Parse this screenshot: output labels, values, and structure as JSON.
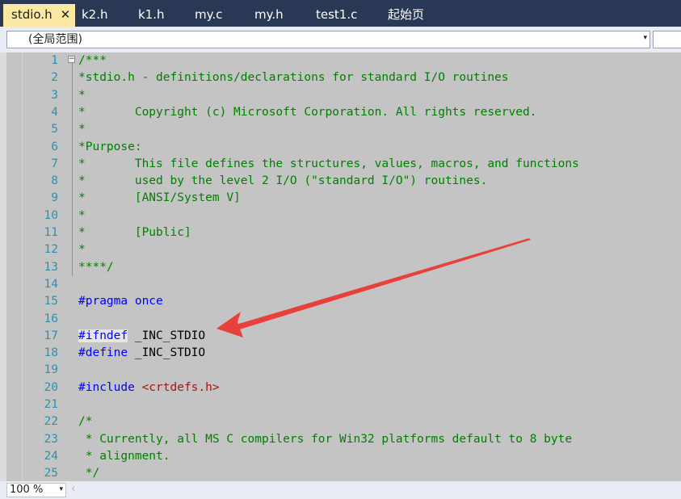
{
  "tabs": [
    {
      "label": "stdio.h",
      "active": true
    },
    {
      "label": "k2.h"
    },
    {
      "label": "k1.h"
    },
    {
      "label": "my.c"
    },
    {
      "label": "my.h"
    },
    {
      "label": "test1.c"
    },
    {
      "label": "起始页"
    }
  ],
  "tab_close_glyph": "✕",
  "scope": {
    "value": "(全局范围)",
    "dropdown_glyph": "▾"
  },
  "lines": [
    {
      "n": "1",
      "segs": [
        {
          "c": "cm",
          "t": "/***"
        }
      ]
    },
    {
      "n": "2",
      "segs": [
        {
          "c": "cm",
          "t": "*stdio.h - definitions/declarations for standard I/O routines"
        }
      ]
    },
    {
      "n": "3",
      "segs": [
        {
          "c": "cm",
          "t": "*"
        }
      ]
    },
    {
      "n": "4",
      "segs": [
        {
          "c": "cm",
          "t": "*       Copyright (c) Microsoft Corporation. All rights reserved."
        }
      ]
    },
    {
      "n": "5",
      "segs": [
        {
          "c": "cm",
          "t": "*"
        }
      ]
    },
    {
      "n": "6",
      "segs": [
        {
          "c": "cm",
          "t": "*Purpose:"
        }
      ]
    },
    {
      "n": "7",
      "segs": [
        {
          "c": "cm",
          "t": "*       This file defines the structures, values, macros, and functions"
        }
      ]
    },
    {
      "n": "8",
      "segs": [
        {
          "c": "cm",
          "t": "*       used by the level 2 I/O (\"standard I/O\") routines."
        }
      ]
    },
    {
      "n": "9",
      "segs": [
        {
          "c": "cm",
          "t": "*       [ANSI/System V]"
        }
      ]
    },
    {
      "n": "10",
      "segs": [
        {
          "c": "cm",
          "t": "*"
        }
      ]
    },
    {
      "n": "11",
      "segs": [
        {
          "c": "cm",
          "t": "*       [Public]"
        }
      ]
    },
    {
      "n": "12",
      "segs": [
        {
          "c": "cm",
          "t": "*"
        }
      ]
    },
    {
      "n": "13",
      "segs": [
        {
          "c": "cm",
          "t": "****/"
        }
      ]
    },
    {
      "n": "14",
      "segs": []
    },
    {
      "n": "15",
      "segs": [
        {
          "c": "pp",
          "t": "#pragma"
        },
        {
          "c": "tx",
          "t": " "
        },
        {
          "c": "pp",
          "t": "once"
        }
      ]
    },
    {
      "n": "16",
      "segs": []
    },
    {
      "n": "17",
      "segs": [
        {
          "c": "pp hl",
          "t": "#ifndef"
        },
        {
          "c": "tx",
          "t": " _INC_STDIO"
        }
      ]
    },
    {
      "n": "18",
      "segs": [
        {
          "c": "pp",
          "t": "#define"
        },
        {
          "c": "tx",
          "t": " _INC_STDIO"
        }
      ]
    },
    {
      "n": "19",
      "segs": []
    },
    {
      "n": "20",
      "segs": [
        {
          "c": "pp",
          "t": "#include"
        },
        {
          "c": "tx",
          "t": " "
        },
        {
          "c": "str",
          "t": "<crtdefs.h>"
        }
      ]
    },
    {
      "n": "21",
      "segs": []
    },
    {
      "n": "22",
      "segs": [
        {
          "c": "cm",
          "t": "/*"
        }
      ]
    },
    {
      "n": "23",
      "segs": [
        {
          "c": "cm",
          "t": " * Currently, all MS C compilers for Win32 platforms default to 8 byte"
        }
      ]
    },
    {
      "n": "24",
      "segs": [
        {
          "c": "cm",
          "t": " * alignment."
        }
      ]
    },
    {
      "n": "25",
      "segs": [
        {
          "c": "cm",
          "t": " */"
        }
      ]
    }
  ],
  "colors": {
    "comment": "#008000",
    "preprocessor": "#0000ff",
    "string": "#a31515",
    "line_number": "#2b91af",
    "arrow": "#e8403a"
  },
  "zoom": {
    "value": "100 %",
    "dropdown_glyph": "▾"
  },
  "fold_glyph": "−",
  "scroll_left_glyph": "‹"
}
